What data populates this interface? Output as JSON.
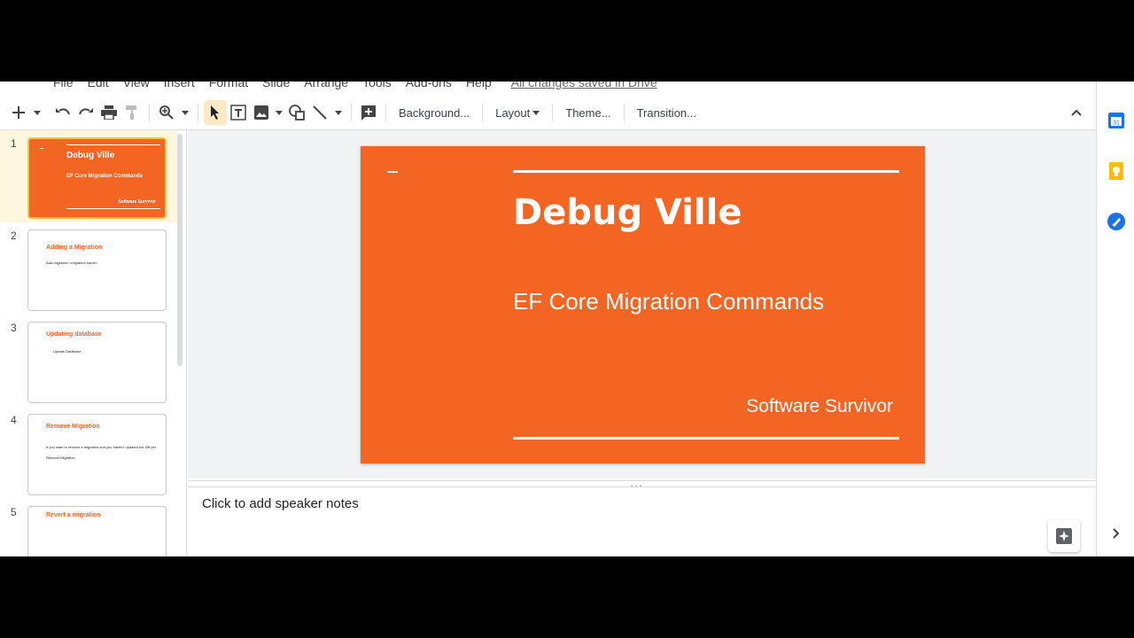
{
  "menu": {
    "items": [
      "File",
      "Edit",
      "View",
      "Insert",
      "Format",
      "Slide",
      "Arrange",
      "Tools",
      "Add-ons",
      "Help"
    ],
    "save_status": "All changes saved in Drive"
  },
  "toolbar": {
    "background_label": "Background...",
    "layout_label": "Layout",
    "theme_label": "Theme...",
    "transition_label": "Transition..."
  },
  "slides": [
    {
      "number": "1",
      "title": "Debug Ville",
      "subtitle": "EF Core Migration Commands",
      "author": "Software Survivor"
    },
    {
      "number": "2",
      "title": "Adding a Migration",
      "body": "Add-migration <migration name>"
    },
    {
      "number": "3",
      "title": "Updating database",
      "body": "Update-Database"
    },
    {
      "number": "4",
      "title": "Remove Migration",
      "body": "If you want to remove a migration and you haven't updated the DB yet",
      "body2": "Remove-Migration"
    },
    {
      "number": "5",
      "title": "Revert a migration"
    }
  ],
  "current_slide": {
    "title": "Debug Ville",
    "subtitle": "EF Core Migration Commands",
    "author": "Software Survivor"
  },
  "notes": {
    "placeholder": "Click to add speaker notes"
  },
  "colors": {
    "slide_bg": "#f26522",
    "selected_thumb_border": "#f7c242"
  }
}
